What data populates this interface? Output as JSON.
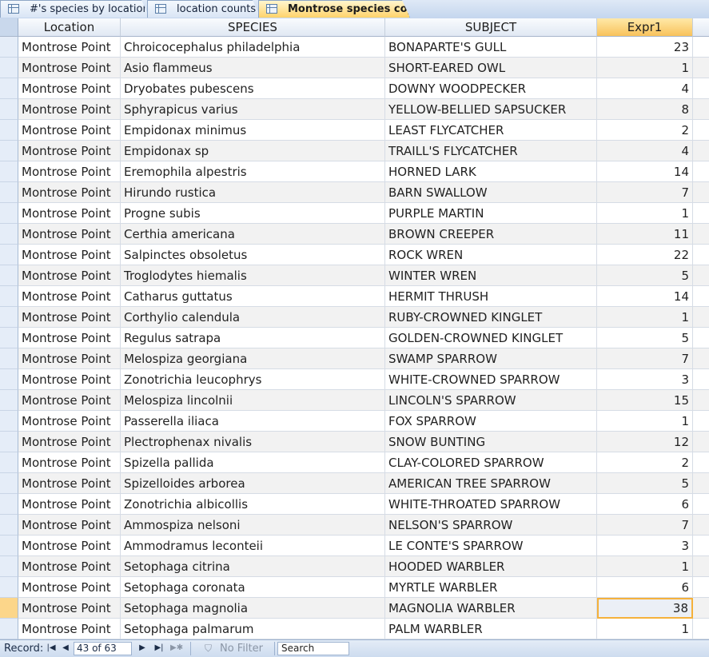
{
  "tabs": [
    {
      "label": "#'s species by location",
      "active": false
    },
    {
      "label": "location counts",
      "active": false
    },
    {
      "label": "Montrose species copy",
      "active": true
    }
  ],
  "columns": [
    "Location",
    "SPECIES",
    "SUBJECT",
    "Expr1"
  ],
  "rows": [
    [
      "Montrose Point",
      "Chroicocephalus philadelphia",
      "BONAPARTE'S GULL",
      "23"
    ],
    [
      "Montrose Point",
      "Asio flammeus",
      "SHORT-EARED OWL",
      "1"
    ],
    [
      "Montrose Point",
      "Dryobates pubescens",
      "DOWNY WOODPECKER",
      "4"
    ],
    [
      "Montrose Point",
      "Sphyrapicus varius",
      "YELLOW-BELLIED SAPSUCKER",
      "8"
    ],
    [
      "Montrose Point",
      "Empidonax minimus",
      "LEAST FLYCATCHER",
      "2"
    ],
    [
      "Montrose Point",
      "Empidonax sp",
      "TRAILL'S FLYCATCHER",
      "4"
    ],
    [
      "Montrose Point",
      "Eremophila alpestris",
      "HORNED LARK",
      "14"
    ],
    [
      "Montrose Point",
      "Hirundo rustica",
      "BARN SWALLOW",
      "7"
    ],
    [
      "Montrose Point",
      "Progne subis",
      "PURPLE MARTIN",
      "1"
    ],
    [
      "Montrose Point",
      "Certhia americana",
      "BROWN CREEPER",
      "11"
    ],
    [
      "Montrose Point",
      "Salpinctes obsoletus",
      "ROCK WREN",
      "22"
    ],
    [
      "Montrose Point",
      "Troglodytes hiemalis",
      "WINTER WREN",
      "5"
    ],
    [
      "Montrose Point",
      "Catharus guttatus",
      "HERMIT THRUSH",
      "14"
    ],
    [
      "Montrose Point",
      "Corthylio calendula",
      "RUBY-CROWNED KINGLET",
      "1"
    ],
    [
      "Montrose Point",
      "Regulus satrapa",
      "GOLDEN-CROWNED KINGLET",
      "5"
    ],
    [
      "Montrose Point",
      "Melospiza georgiana",
      "SWAMP SPARROW",
      "7"
    ],
    [
      "Montrose Point",
      "Zonotrichia leucophrys",
      "WHITE-CROWNED SPARROW",
      "3"
    ],
    [
      "Montrose Point",
      "Melospiza lincolnii",
      "LINCOLN'S SPARROW",
      "15"
    ],
    [
      "Montrose Point",
      "Passerella iliaca",
      "FOX SPARROW",
      "1"
    ],
    [
      "Montrose Point",
      "Plectrophenax nivalis",
      "SNOW BUNTING",
      "12"
    ],
    [
      "Montrose Point",
      "Spizella pallida",
      "CLAY-COLORED SPARROW",
      "2"
    ],
    [
      "Montrose Point",
      "Spizelloides arborea",
      "AMERICAN TREE SPARROW",
      "5"
    ],
    [
      "Montrose Point",
      "Zonotrichia albicollis",
      "WHITE-THROATED SPARROW",
      "6"
    ],
    [
      "Montrose Point",
      "Ammospiza nelsoni",
      "NELSON'S SPARROW",
      "7"
    ],
    [
      "Montrose Point",
      "Ammodramus leconteii",
      "LE CONTE'S SPARROW",
      "3"
    ],
    [
      "Montrose Point",
      "Setophaga citrina",
      "HOODED WARBLER",
      "1"
    ],
    [
      "Montrose Point",
      "Setophaga coronata",
      "MYRTLE WARBLER",
      "6"
    ],
    [
      "Montrose Point",
      "Setophaga magnolia",
      "MAGNOLIA WARBLER",
      "38"
    ],
    [
      "Montrose Point",
      "Setophaga palmarum",
      "PALM WARBLER",
      "1"
    ]
  ],
  "current_row_index": 27,
  "status": {
    "record_label": "Record:",
    "first_icon": "first-record-icon",
    "prev_icon": "previous-record-icon",
    "position": "43 of 63",
    "next_icon": "next-record-icon",
    "last_icon": "last-record-icon",
    "new_icon": "new-record-icon",
    "filter_icon": "filter-icon",
    "filter_label": "No Filter",
    "search_placeholder": "Search"
  },
  "colors": {
    "active_tab": "#ffd36b",
    "selected_header": "#f8c25b",
    "current_row_selector": "#fcd68a",
    "focus_border": "#f5b13b"
  }
}
